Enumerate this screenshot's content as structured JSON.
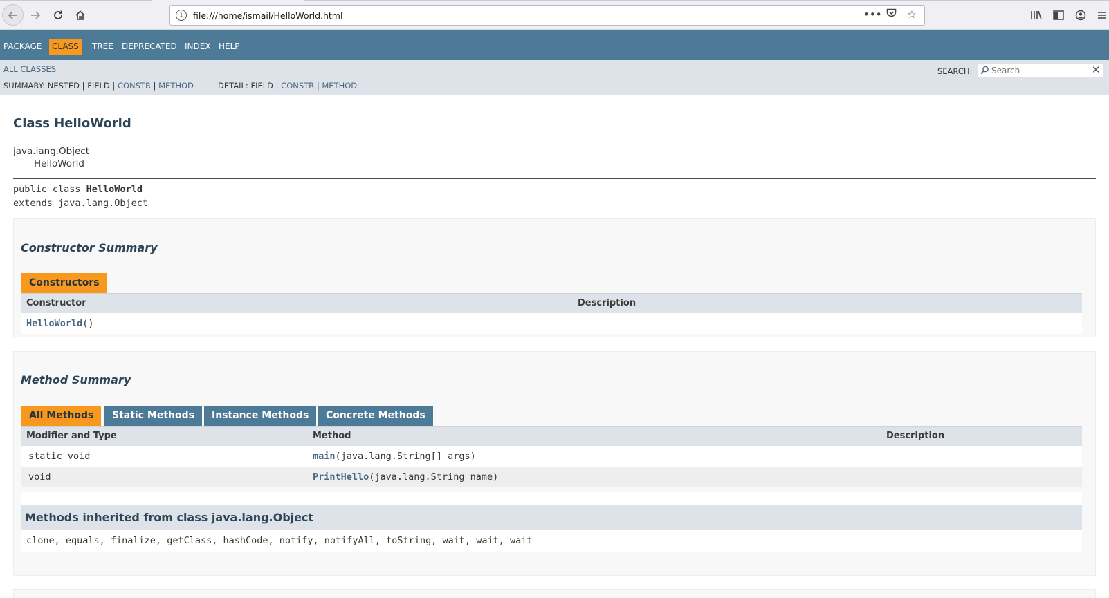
{
  "browser": {
    "url": "file:///home/ismail/HelloWorld.html",
    "icons": {
      "back": "back-arrow-icon",
      "forward": "forward-arrow-icon",
      "reload": "reload-icon",
      "home": "home-icon",
      "site_info": "info-icon",
      "page_actions": "more-dots-icon",
      "pocket": "pocket-icon",
      "bookmark": "star-icon",
      "library": "library-icon",
      "sidebar": "sidebar-icon",
      "account": "account-icon",
      "menu": "hamburger-menu-icon"
    }
  },
  "topnav": {
    "items": [
      "PACKAGE",
      "CLASS",
      "TREE",
      "DEPRECATED",
      "INDEX",
      "HELP"
    ],
    "active": "CLASS"
  },
  "subnav": {
    "all_classes": "ALL CLASSES",
    "summary_label": "SUMMARY: NESTED | FIELD | ",
    "summary_constr": "CONSTR",
    "summary_sep": " | ",
    "summary_method": "METHOD",
    "detail_label": "DETAIL: FIELD | ",
    "detail_constr": "CONSTR",
    "detail_sep": " | ",
    "detail_method": "METHOD",
    "search_label": "SEARCH:",
    "search_placeholder": "Search"
  },
  "content": {
    "title": "Class HelloWorld",
    "inheritance": [
      "java.lang.Object",
      "HelloWorld"
    ],
    "signature_prefix": "public class ",
    "signature_name": "HelloWorld",
    "signature_extends": "extends java.lang.Object"
  },
  "constructor_summary": {
    "heading": "Constructor Summary",
    "tab": "Constructors",
    "columns": [
      "Constructor",
      "Description"
    ],
    "rows": [
      {
        "name": "HelloWorld",
        "params": "()",
        "description": ""
      }
    ]
  },
  "method_summary": {
    "heading": "Method Summary",
    "tabs": [
      "All Methods",
      "Static Methods",
      "Instance Methods",
      "Concrete Methods"
    ],
    "active_tab": "All Methods",
    "columns": [
      "Modifier and Type",
      "Method",
      "Description"
    ],
    "rows": [
      {
        "modifier": "static void",
        "name": "main",
        "params": "(java.lang.String[] args)",
        "description": ""
      },
      {
        "modifier": "void",
        "name": "PrintHello",
        "params": "(java.lang.String name)",
        "description": ""
      }
    ],
    "inherited_heading": "Methods inherited from class java.lang.Object",
    "inherited_methods": "clone, equals, finalize, getClass, hashCode, notify, notifyAll, toString, wait, wait, wait"
  },
  "colors": {
    "nav_blue": "#4d7a97",
    "accent_orange": "#f8981d",
    "subnav_bg": "#dee3e9",
    "link": "#4a6782"
  }
}
